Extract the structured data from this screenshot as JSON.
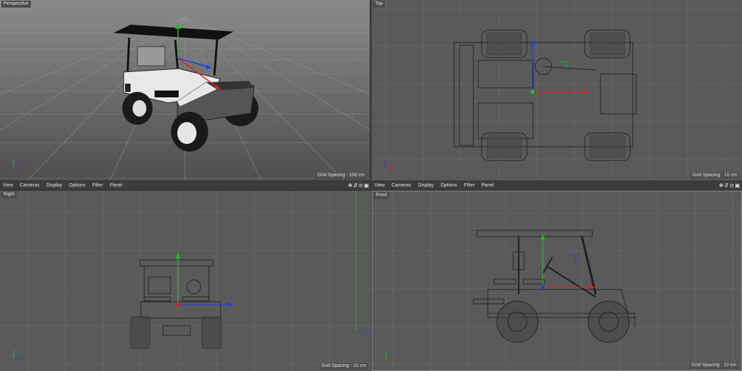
{
  "viewports": {
    "perspective": {
      "label": "Perspective",
      "grid_spacing": "Grid Spacing : 100 cm"
    },
    "top": {
      "label": "Top",
      "grid_spacing": "Grid Spacing : 10 cm"
    },
    "right": {
      "label": "Right",
      "grid_spacing": "Grid Spacing : 10 cm"
    },
    "front": {
      "label": "Front",
      "grid_spacing": "Grid Spacing : 10 cm"
    }
  },
  "menu": {
    "view": "View",
    "cameras": "Cameras",
    "display": "Display",
    "options": "Options",
    "filter": "Filter",
    "panel": "Panel"
  },
  "nav_icons": {
    "move": "✥",
    "zoom": "⇵",
    "rotate": "⊘",
    "maximize": "▣"
  },
  "axis_colors": {
    "x": "#e02020",
    "y": "#20c020",
    "z": "#2040e0"
  }
}
